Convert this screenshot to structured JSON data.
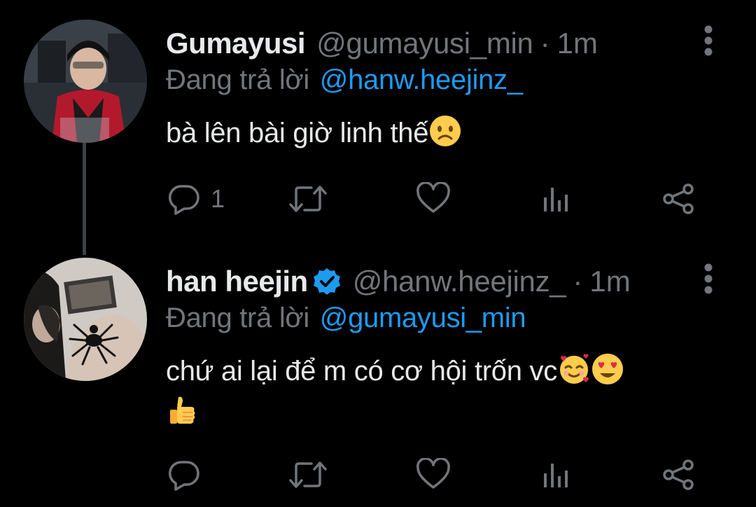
{
  "tweets": [
    {
      "display_name": "Gumayusi",
      "handle": "@gumayusi_min",
      "separator": "·",
      "time": "1m",
      "replying_prefix": "Đang trả lời",
      "replying_to": "@hanw.heejinz_",
      "text": "bà lên bài giờ linh thế",
      "text_line2": "",
      "emojis": [
        "frowning-face"
      ],
      "verified": false,
      "reply_count": "1"
    },
    {
      "display_name": "han heejin",
      "handle": "@hanw.heejinz_",
      "separator": "·",
      "time": "1m",
      "replying_prefix": "Đang trả lời",
      "replying_to": "@gumayusi_min",
      "text": "chứ ai lại để m có cơ hội trốn vc",
      "emojis": [
        "smiling-face-with-hearts",
        "heart-eyes-face",
        "thumbs-up"
      ],
      "verified": true,
      "reply_count": ""
    }
  ],
  "colors": {
    "background": "#000000",
    "text": "#e7e9ea",
    "muted": "#71767b",
    "link": "#1d9bf0",
    "verified": "#1d9bf0",
    "thread_line": "#3e4144"
  },
  "icons": [
    "reply-icon",
    "retweet-icon",
    "like-icon",
    "views-icon",
    "share-icon",
    "more-icon",
    "verified-icon"
  ]
}
